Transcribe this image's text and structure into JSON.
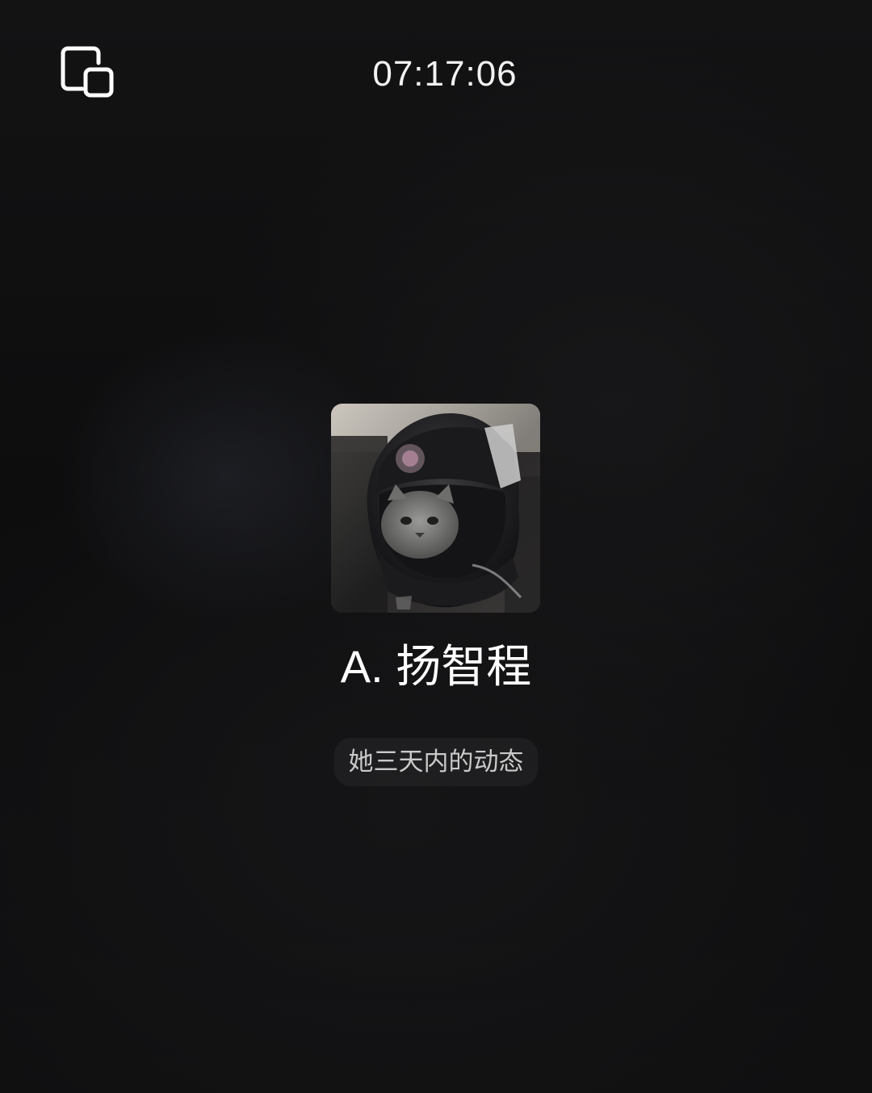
{
  "call": {
    "timer": "07:17:06"
  },
  "toolbar": {
    "floating_window_icon": "floating-window-icon"
  },
  "contact": {
    "name": "A. 扬智程",
    "avatar_icon": "cat-in-helmet-avatar"
  },
  "moments": {
    "label": "她三天内的动态"
  },
  "colors": {
    "background": "#0e0e0f",
    "text_primary": "#ffffff",
    "text_secondary": "#c9c9c9"
  }
}
